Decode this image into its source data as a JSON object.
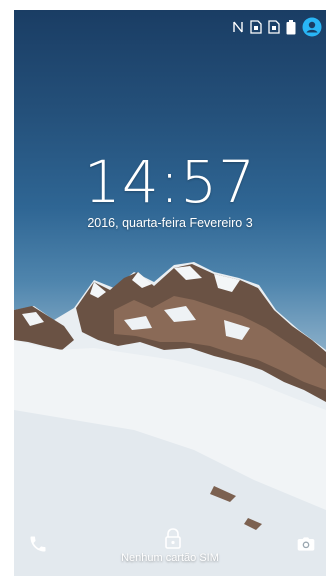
{
  "lockscreen": {
    "time": "14:57",
    "date": "2016, quarta-feira Fevereiro 3",
    "sim_status": "Nenhum cartão SIM"
  },
  "status_bar": {
    "icons": [
      "nfc-icon",
      "no-sim-icon",
      "no-sim-icon",
      "battery-icon",
      "user-avatar-icon"
    ],
    "accent_color": "#29b6f6"
  },
  "bottom_actions": {
    "left": "phone-icon",
    "center": "lock-icon",
    "right": "camera-icon"
  }
}
